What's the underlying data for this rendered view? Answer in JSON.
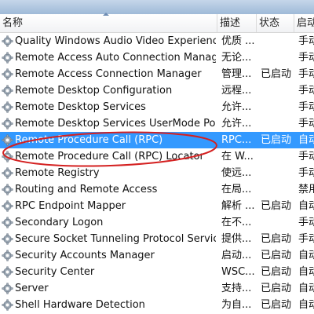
{
  "header": {
    "name": "名称",
    "description": "描述",
    "status": "状态",
    "startup": "启动"
  },
  "services": [
    {
      "name": "Quality Windows Audio Video Experience",
      "description": "优质 ...",
      "status": "",
      "startup": "手动"
    },
    {
      "name": "Remote Access Auto Connection Manager",
      "description": "无论...",
      "status": "",
      "startup": "手动"
    },
    {
      "name": "Remote Access Connection Manager",
      "description": "管理...",
      "status": "已启动",
      "startup": "手动"
    },
    {
      "name": "Remote Desktop Configuration",
      "description": "远程...",
      "status": "",
      "startup": "手动"
    },
    {
      "name": "Remote Desktop Services",
      "description": "允许...",
      "status": "",
      "startup": "手动"
    },
    {
      "name": "Remote Desktop Services UserMode Port ...",
      "description": "允许...",
      "status": "",
      "startup": "手动"
    },
    {
      "name": "Remote Procedure Call (RPC)",
      "description": "RPC...",
      "status": "已启动",
      "startup": "自动"
    },
    {
      "name": "Remote Procedure Call (RPC) Locator",
      "description": "在 W...",
      "status": "",
      "startup": "手动"
    },
    {
      "name": "Remote Registry",
      "description": "使远...",
      "status": "",
      "startup": "手动"
    },
    {
      "name": "Routing and Remote Access",
      "description": "在局...",
      "status": "",
      "startup": "禁用"
    },
    {
      "name": "RPC Endpoint Mapper",
      "description": "解析 ...",
      "status": "已启动",
      "startup": "自动"
    },
    {
      "name": "Secondary Logon",
      "description": "在不...",
      "status": "",
      "startup": "手动"
    },
    {
      "name": "Secure Socket Tunneling Protocol Service",
      "description": "提供...",
      "status": "已启动",
      "startup": "手动"
    },
    {
      "name": "Security Accounts Manager",
      "description": "启动...",
      "status": "已启动",
      "startup": "自动"
    },
    {
      "name": "Security Center",
      "description": "WSC...",
      "status": "已启动",
      "startup": "自动"
    },
    {
      "name": "Server",
      "description": "支持...",
      "status": "已启动",
      "startup": "自动"
    },
    {
      "name": "Shell Hardware Detection",
      "description": "为自...",
      "status": "已启动",
      "startup": "自动"
    }
  ],
  "selected_index": 6,
  "icon": "gear-icon",
  "colors": {
    "selection": "#3399ff",
    "annotation": "#d42020"
  }
}
